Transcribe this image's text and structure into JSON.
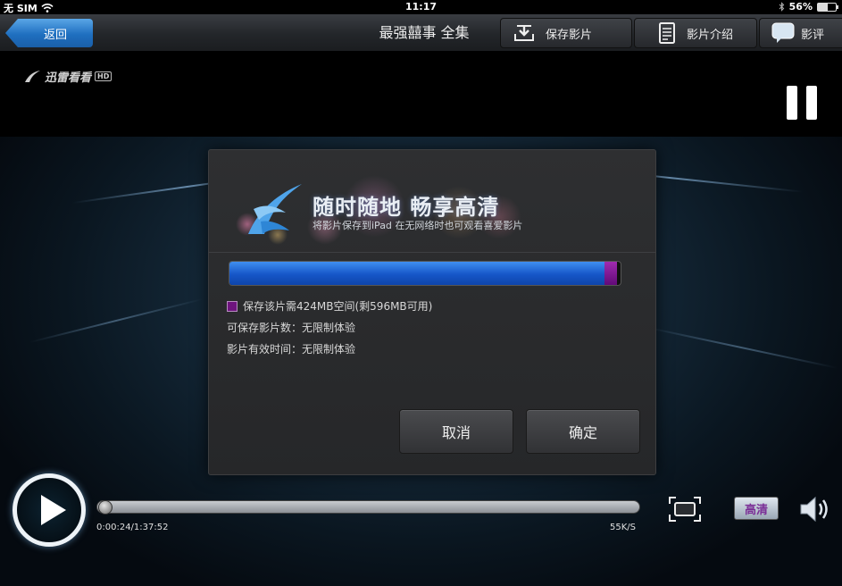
{
  "status_bar": {
    "carrier": "无 SIM",
    "time": "11:17",
    "battery": "56%",
    "battery_level": 0.56
  },
  "top_bar": {
    "back_label": "返回",
    "title": "最强囍事  全集",
    "save_label": "保存影片",
    "intro_label": "影片介绍",
    "review_label": "影评"
  },
  "player": {
    "logo_text": "迅雷看看",
    "logo_badge": "HD",
    "elapsed_time": "0:00:24/1:37:52",
    "seek_progress": 0.004,
    "speed": "55K/S",
    "quality_label": "高清"
  },
  "dialog": {
    "headline": "随时随地  畅享高清",
    "subline": "将影片保存到iPad 在无网络时也可观看喜爱影片",
    "storage_used_fraction": 0.96,
    "required_fraction": 0.03,
    "space_info": "保存该片需424MB空间(剩596MB可用)",
    "saveable_count": "可保存影片数：无限制体验",
    "valid_time": "影片有效时间：无限制体验",
    "cancel_label": "取消",
    "confirm_label": "确定"
  },
  "colors": {
    "accent_blue": "#1f6fc0",
    "required_purple": "#6e147e",
    "hd_text": "#7b2f97"
  }
}
